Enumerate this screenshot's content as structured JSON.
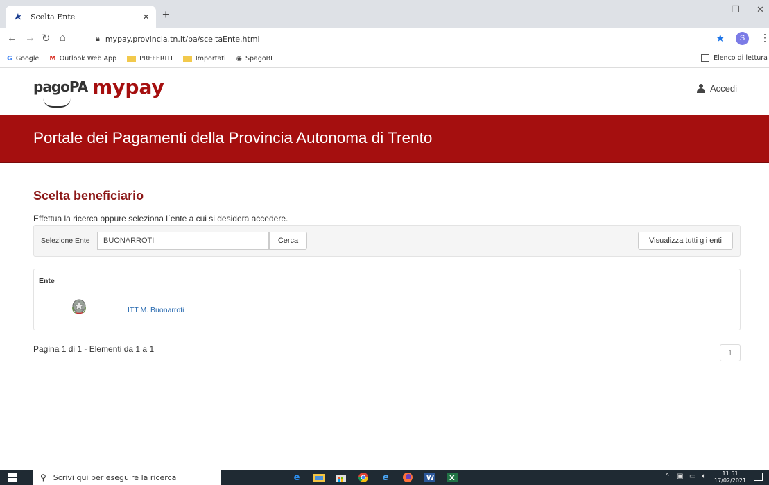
{
  "browser": {
    "tab_title": "Scelta Ente",
    "url": "mypay.provincia.tn.it/pa/sceltaEnte.html",
    "profile_initial": "S",
    "bookmarks": [
      {
        "label": "Google",
        "icon": "google-icon"
      },
      {
        "label": "Outlook Web App",
        "icon": "gmail-icon"
      },
      {
        "label": "PREFERITI",
        "icon": "folder-icon"
      },
      {
        "label": "Importati",
        "icon": "folder-icon"
      },
      {
        "label": "SpagoBI",
        "icon": "globe-icon"
      }
    ],
    "reading_list": "Elenco di lettura"
  },
  "header": {
    "logo_pagopa": "pagoPA",
    "logo_mypay": "mypay",
    "login_label": "Accedi",
    "banner_title": "Portale dei Pagamenti della Provincia Autonoma di Trento",
    "brand_color": "#a50f0f"
  },
  "main": {
    "section_title": "Scelta beneficiario",
    "intro": "Effettua la ricerca oppure seleziona l´ente a cui si desidera accedere.",
    "search": {
      "label": "Selezione Ente",
      "value": "BUONARROTI",
      "search_button": "Cerca",
      "show_all_button": "Visualizza tutti gli enti"
    },
    "table": {
      "header": "Ente",
      "rows": [
        {
          "name": "ITT M. Buonarroti",
          "icon": "italian-emblem-icon"
        }
      ]
    },
    "pagination": {
      "summary": "Pagina 1 di 1 - Elementi da 1 a 1",
      "current_page": "1"
    }
  },
  "taskbar": {
    "search_placeholder": "Scrivi qui per eseguire la ricerca",
    "time": "11:51",
    "date": "17/02/2021"
  }
}
